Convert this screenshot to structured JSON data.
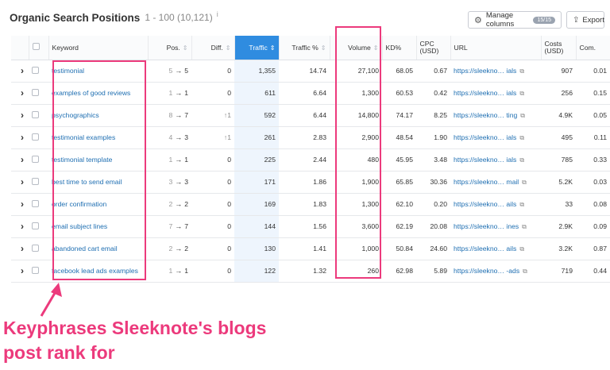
{
  "header": {
    "title": "Organic Search Positions",
    "range": "1 - 100 (10,121)",
    "info_icon": "i"
  },
  "toolbar": {
    "manage_columns_label": "Manage columns",
    "manage_columns_badge": "15/15",
    "export_label": "Export"
  },
  "table": {
    "columns": {
      "keyword": "Keyword",
      "pos": "Pos.",
      "diff": "Diff.",
      "traffic": "Traffic",
      "traffic_pct": "Traffic %",
      "volume": "Volume",
      "kd": "KD%",
      "cpc_1": "CPC",
      "cpc_2": "(USD)",
      "url": "URL",
      "costs_1": "Costs",
      "costs_2": "(USD)",
      "com": "Com."
    },
    "rows": [
      {
        "keyword": "testimonial",
        "pos_old": "5",
        "pos_new": "5",
        "diff": "0",
        "traffic": "1,355",
        "traffic_pct": "14.74",
        "volume": "27,100",
        "kd": "68.05",
        "cpc": "0.67",
        "url_start": "https://sleekno…",
        "url_end": "ials",
        "costs": "907",
        "com": "0.01"
      },
      {
        "keyword": "examples of good reviews",
        "pos_old": "1",
        "pos_new": "1",
        "diff": "0",
        "traffic": "611",
        "traffic_pct": "6.64",
        "volume": "1,300",
        "kd": "60.53",
        "cpc": "0.42",
        "url_start": "https://sleekno…",
        "url_end": "ials",
        "costs": "256",
        "com": "0.15"
      },
      {
        "keyword": "psychographics",
        "pos_old": "8",
        "pos_new": "7",
        "diff": "↑1",
        "traffic": "592",
        "traffic_pct": "6.44",
        "volume": "14,800",
        "kd": "74.17",
        "cpc": "8.25",
        "url_start": "https://sleekno…",
        "url_end": "ting",
        "costs": "4.9K",
        "com": "0.05"
      },
      {
        "keyword": "testimonial examples",
        "pos_old": "4",
        "pos_new": "3",
        "diff": "↑1",
        "traffic": "261",
        "traffic_pct": "2.83",
        "volume": "2,900",
        "kd": "48.54",
        "cpc": "1.90",
        "url_start": "https://sleekno…",
        "url_end": "ials",
        "costs": "495",
        "com": "0.11"
      },
      {
        "keyword": "testimonial template",
        "pos_old": "1",
        "pos_new": "1",
        "diff": "0",
        "traffic": "225",
        "traffic_pct": "2.44",
        "volume": "480",
        "kd": "45.95",
        "cpc": "3.48",
        "url_start": "https://sleekno…",
        "url_end": "ials",
        "costs": "785",
        "com": "0.33"
      },
      {
        "keyword": "best time to send email",
        "pos_old": "3",
        "pos_new": "3",
        "diff": "0",
        "traffic": "171",
        "traffic_pct": "1.86",
        "volume": "1,900",
        "kd": "65.85",
        "cpc": "30.36",
        "url_start": "https://sleekno…",
        "url_end": "mail",
        "costs": "5.2K",
        "com": "0.03"
      },
      {
        "keyword": "order confirmation",
        "pos_old": "2",
        "pos_new": "2",
        "diff": "0",
        "traffic": "169",
        "traffic_pct": "1.83",
        "volume": "1,300",
        "kd": "62.10",
        "cpc": "0.20",
        "url_start": "https://sleekno…",
        "url_end": "ails",
        "costs": "33",
        "com": "0.08"
      },
      {
        "keyword": "email subject lines",
        "pos_old": "7",
        "pos_new": "7",
        "diff": "0",
        "traffic": "144",
        "traffic_pct": "1.56",
        "volume": "3,600",
        "kd": "62.19",
        "cpc": "20.08",
        "url_start": "https://sleekno…",
        "url_end": "ines",
        "costs": "2.9K",
        "com": "0.09"
      },
      {
        "keyword": "abandoned cart email",
        "pos_old": "2",
        "pos_new": "2",
        "diff": "0",
        "traffic": "130",
        "traffic_pct": "1.41",
        "volume": "1,000",
        "kd": "50.84",
        "cpc": "24.60",
        "url_start": "https://sleekno…",
        "url_end": "ails",
        "costs": "3.2K",
        "com": "0.87"
      },
      {
        "keyword": "facebook lead ads examples",
        "pos_old": "1",
        "pos_new": "1",
        "diff": "0",
        "traffic": "122",
        "traffic_pct": "1.32",
        "volume": "260",
        "kd": "62.98",
        "cpc": "5.89",
        "url_start": "https://sleekno…",
        "url_end": "-ads",
        "costs": "719",
        "com": "0.44"
      }
    ]
  },
  "annotation": {
    "line1": "Keyphrases Sleeknote's blogs",
    "line2": "post rank for",
    "color": "#ec3a7c"
  },
  "icons": {
    "gear": "gear-icon",
    "export": "export-icon",
    "expand": "chevron-right-icon",
    "external": "external-link-icon",
    "sort": "sort-icon"
  }
}
